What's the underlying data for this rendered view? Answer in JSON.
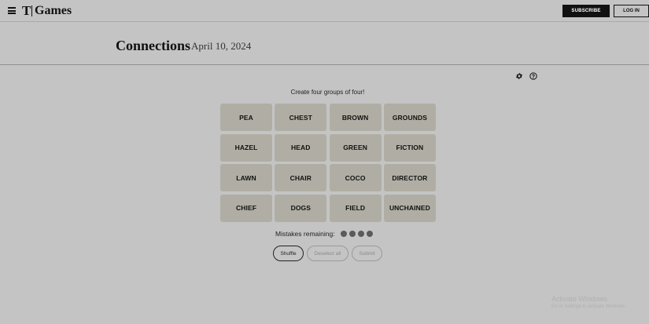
{
  "header": {
    "logo_mark": "T",
    "logo_text": "Games",
    "subscribe_label": "SUBSCRIBE",
    "login_label": "LOG IN"
  },
  "title": {
    "game": "Connections",
    "date": "April 10, 2024"
  },
  "icons": {
    "settings": "gear-icon",
    "help": "help-icon",
    "menu": "menu-icon"
  },
  "board": {
    "instructions": "Create four groups of four!",
    "tiles": [
      "PEA",
      "CHEST",
      "BROWN",
      "GROUNDS",
      "HAZEL",
      "HEAD",
      "GREEN",
      "FICTION",
      "LAWN",
      "CHAIR",
      "COCO",
      "DIRECTOR",
      "CHIEF",
      "DOGS",
      "FIELD",
      "UNCHAINED"
    ],
    "mistakes_label": "Mistakes remaining:",
    "mistakes_remaining": 4
  },
  "actions": {
    "shuffle": "Shuffle",
    "deselect_all": "Deselect all",
    "submit": "Submit"
  },
  "watermark": {
    "line1": "Activate Windows",
    "line2": "Go to Settings to activate Windows."
  },
  "colors": {
    "background": "#c4c4c4",
    "tile": "#b0aea4",
    "dot": "#5a5a5a",
    "subscribe_bg": "#111111"
  }
}
